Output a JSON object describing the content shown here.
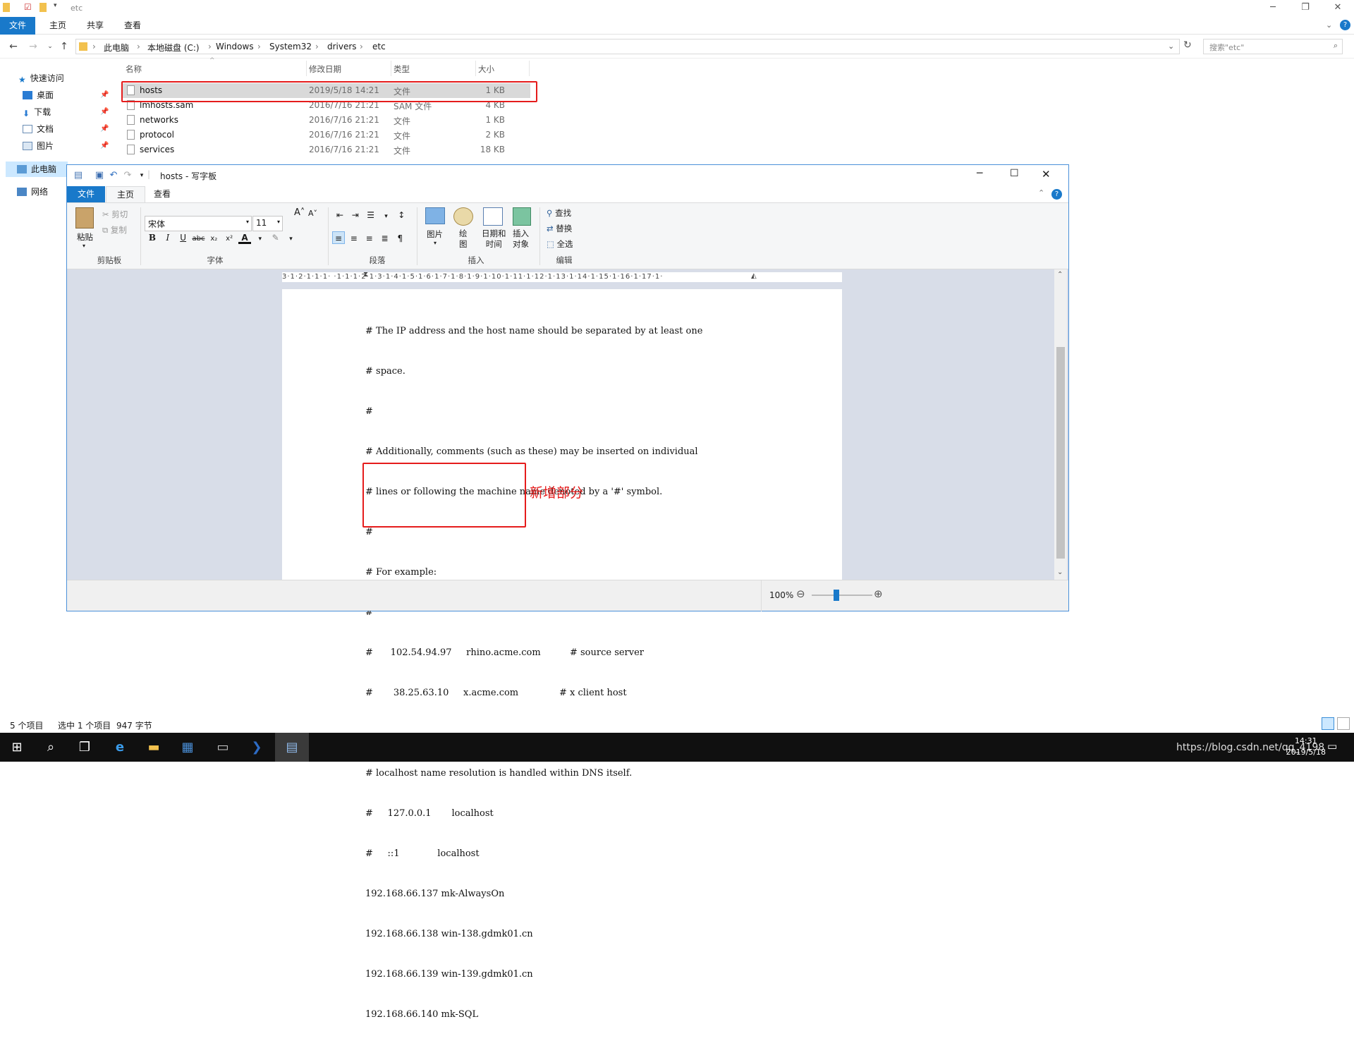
{
  "explorer": {
    "title": "etc",
    "tabs": [
      "文件",
      "主页",
      "共享",
      "查看"
    ],
    "breadcrumbs": [
      "此电脑",
      "本地磁盘 (C:)",
      "Windows",
      "System32",
      "drivers",
      "etc"
    ],
    "search_placeholder": "搜索\"etc\"",
    "nav_pane": {
      "quick_access": "快速访问",
      "items": [
        "桌面",
        "下载",
        "文档",
        "图片"
      ],
      "this_pc": "此电脑",
      "network": "网络"
    },
    "columns": {
      "name": "名称",
      "date": "修改日期",
      "type": "类型",
      "size": "大小"
    },
    "files": [
      {
        "name": "hosts",
        "date": "2019/5/18 14:21",
        "type": "文件",
        "size": "1 KB"
      },
      {
        "name": "lmhosts.sam",
        "date": "2016/7/16 21:21",
        "type": "SAM 文件",
        "size": "4 KB"
      },
      {
        "name": "networks",
        "date": "2016/7/16 21:21",
        "type": "文件",
        "size": "1 KB"
      },
      {
        "name": "protocol",
        "date": "2016/7/16 21:21",
        "type": "文件",
        "size": "2 KB"
      },
      {
        "name": "services",
        "date": "2016/7/16 21:21",
        "type": "文件",
        "size": "18 KB"
      }
    ],
    "status": {
      "count": "5 个项目",
      "selected": "选中 1 个项目",
      "size": "947 字节"
    }
  },
  "wordpad": {
    "title": "hosts - 写字板",
    "tabs": [
      "文件",
      "主页",
      "查看"
    ],
    "clipboard": {
      "paste": "粘贴",
      "cut": "剪切",
      "copy": "复制",
      "group": "剪贴板"
    },
    "font": {
      "name": "宋体",
      "size": "11",
      "group": "字体"
    },
    "paragraph": {
      "group": "段落"
    },
    "insert": {
      "picture": "图片",
      "paint": "绘\n图",
      "datetime": "日期和\n时间",
      "object": "插入\n对象",
      "group": "插入"
    },
    "edit": {
      "find": "查找",
      "replace": "替换",
      "select_all": "全选",
      "group": "编辑"
    },
    "ruler": "3·1·2·1·1·1· ·1·1·1·2·1·3·1·4·1·5·1·6·1·7·1·8·1·9·1·10·1·11·1·12·1·13·1·14·1·15·1·16·1·17·1·",
    "lines": [
      "# The IP address and the host name should be separated by at least one",
      "# space.",
      "#",
      "# Additionally, comments (such as these) may be inserted on individual",
      "# lines or following the machine name denoted by a '#' symbol.",
      "#",
      "# For example:",
      "#",
      "#      102.54.94.97     rhino.acme.com          # source server",
      "#       38.25.63.10     x.acme.com              # x client host",
      "",
      "# localhost name resolution is handled within DNS itself.",
      "#     127.0.0.1       localhost",
      "#     ::1             localhost",
      "192.168.66.137 mk-AlwaysOn",
      "192.168.66.138 win-138.gdmk01.cn",
      "192.168.66.139 win-139.gdmk01.cn",
      "192.168.66.140 mk-SQL"
    ],
    "annotation": "新增部分",
    "zoom": "100%"
  },
  "taskbar": {
    "time": "14:31",
    "date": "2019/5/18",
    "watermark": "https://blog.csdn.net/qq_4198"
  },
  "colors": {
    "accent": "#1979ca",
    "highlight": "#e51c1c"
  }
}
